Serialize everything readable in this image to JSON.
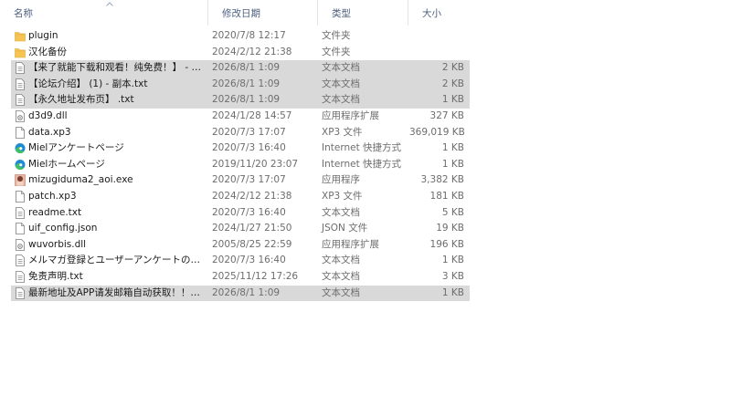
{
  "columns": {
    "name": "名称",
    "date": "修改日期",
    "type": "类型",
    "size": "大小"
  },
  "files": [
    {
      "name": "plugin",
      "date": "2020/7/8 12:17",
      "type": "文件夹",
      "size": "",
      "icon": "folder-icon",
      "selected": false
    },
    {
      "name": "汉化备份",
      "date": "2024/2/12 21:38",
      "type": "文件夹",
      "size": "",
      "icon": "folder-icon",
      "selected": false
    },
    {
      "name": "【来了就能下载和观看！纯免费！】 - 副...",
      "date": "2026/8/1 1:09",
      "type": "文本文档",
      "size": "2 KB",
      "icon": "text-file-icon",
      "selected": true
    },
    {
      "name": "【论坛介绍】 (1) - 副本.txt",
      "date": "2026/8/1 1:09",
      "type": "文本文档",
      "size": "2 KB",
      "icon": "text-file-icon",
      "selected": true
    },
    {
      "name": "【永久地址发布页】 .txt",
      "date": "2026/8/1 1:09",
      "type": "文本文档",
      "size": "1 KB",
      "icon": "text-file-icon",
      "selected": true
    },
    {
      "name": "d3d9.dll",
      "date": "2024/1/28 14:57",
      "type": "应用程序扩展",
      "size": "327 KB",
      "icon": "dll-file-icon",
      "selected": false
    },
    {
      "name": "data.xp3",
      "date": "2020/7/3 17:07",
      "type": "XP3 文件",
      "size": "369,019 KB",
      "icon": "file-icon",
      "selected": false
    },
    {
      "name": "Mielアンケートページ",
      "date": "2020/7/3 16:40",
      "type": "Internet 快捷方式",
      "size": "1 KB",
      "icon": "edge-shortcut-icon",
      "selected": false
    },
    {
      "name": "Mielホームページ",
      "date": "2019/11/20 23:07",
      "type": "Internet 快捷方式",
      "size": "1 KB",
      "icon": "edge-shortcut-icon",
      "selected": false
    },
    {
      "name": "mizugiduma2_aoi.exe",
      "date": "2020/7/3 17:07",
      "type": "应用程序",
      "size": "3,382 KB",
      "icon": "exe-app-icon",
      "selected": false
    },
    {
      "name": "patch.xp3",
      "date": "2024/2/12 21:38",
      "type": "XP3 文件",
      "size": "181 KB",
      "icon": "file-icon",
      "selected": false
    },
    {
      "name": "readme.txt",
      "date": "2020/7/3 16:40",
      "type": "文本文档",
      "size": "5 KB",
      "icon": "text-file-icon",
      "selected": false
    },
    {
      "name": "uif_config.json",
      "date": "2024/1/27 21:50",
      "type": "JSON 文件",
      "size": "19 KB",
      "icon": "file-icon",
      "selected": false
    },
    {
      "name": "wuvorbis.dll",
      "date": "2005/8/25 22:59",
      "type": "应用程序扩展",
      "size": "196 KB",
      "icon": "dll-file-icon",
      "selected": false
    },
    {
      "name": "メルマガ登録とユーザーアンケートのお...",
      "date": "2020/7/3 16:40",
      "type": "文本文档",
      "size": "1 KB",
      "icon": "text-file-icon",
      "selected": false
    },
    {
      "name": "免责声明.txt",
      "date": "2025/11/12 17:26",
      "type": "文本文档",
      "size": "3 KB",
      "icon": "text-file-icon",
      "selected": false
    },
    {
      "name": "最新地址及APP请发邮箱自动获取！！！...",
      "date": "2026/8/1 1:09",
      "type": "文本文档",
      "size": "1 KB",
      "icon": "text-file-icon",
      "selected": true
    }
  ],
  "colors": {
    "selection": "#d9d9d9",
    "header_text": "#4d6082",
    "folder": "#f6c453"
  }
}
